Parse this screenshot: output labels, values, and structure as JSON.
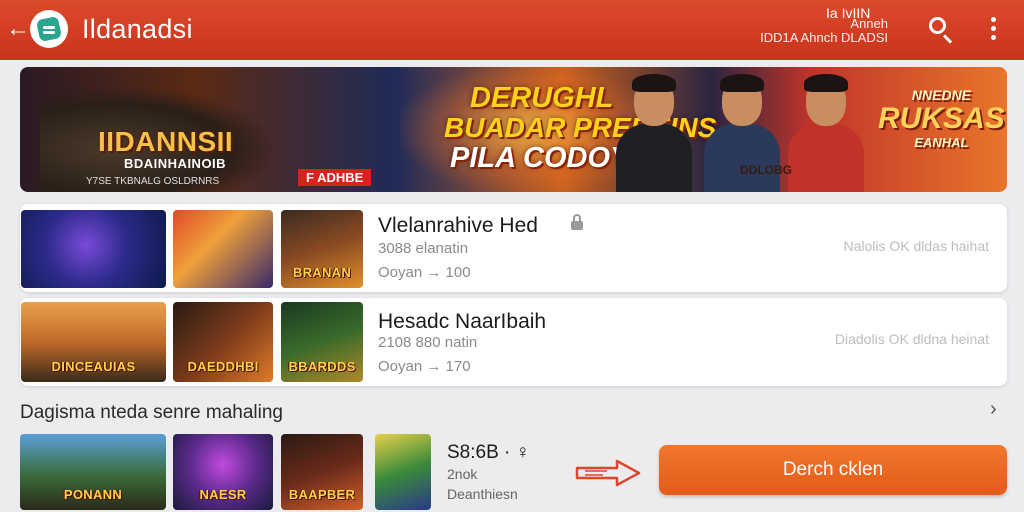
{
  "header": {
    "title": "Ildanadsi",
    "meta_top": "Ia IvIIN",
    "meta_small": "Anneh\nIDD1A Ahnch DLADSI",
    "icons": {
      "back": "back-arrow-icon",
      "logo": "app-logo-icon",
      "search": "search-icon",
      "more": "more-vert-icon"
    }
  },
  "banner": {
    "left_title": "IIDANNSII",
    "left_subtitle": "BDAINHAINOIB",
    "left_fine": "Y7SE TKBNALG OSLDRNRS",
    "badge": "F ADHBE",
    "headline": [
      "DERUGHL",
      "BUADAR PREBEINS",
      "PILA CODOY!"
    ],
    "right_logo": {
      "top": "NNEDNE",
      "main": "RUKSAS",
      "bottom": "EANHAL"
    },
    "corner": "DDLOBG"
  },
  "games": [
    {
      "title": "Vlelanrahive Hed",
      "line1": "3088 elanatin",
      "line2": "Ooyan → 100",
      "right": "Nalolis OK dldas haihat",
      "thumbs": [
        "",
        "",
        "BRANAN"
      ]
    },
    {
      "title": "Hesadc NaarIbaih",
      "line1": "2108 880 natin",
      "line2": "Ooyan → 170",
      "right": "Diadolis OK dldna heinat",
      "thumbs": [
        "DINCEAUIAS",
        "DAEDDHBI",
        "BBARDDS"
      ]
    }
  ],
  "section": {
    "title": "Dagisma nteda senre mahaling"
  },
  "bottom": {
    "thumbs": [
      "PONANN",
      "NAESR",
      "BAAPBER",
      ""
    ],
    "price": "S8:6B · ♀",
    "line1": "2nok",
    "line2": "Deanthiesn",
    "cta_label": "Derch cklen"
  },
  "colors": {
    "header": "#d2402a",
    "cta": "#e8621f",
    "background": "#ececef"
  }
}
